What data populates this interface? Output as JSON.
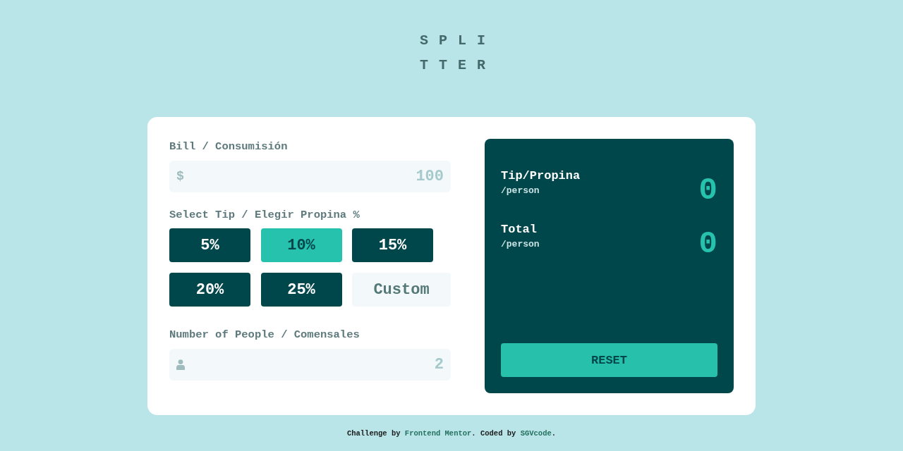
{
  "logo": "SPLITTER",
  "bill": {
    "label": "Bill / Consumisión",
    "prefix": "$",
    "placeholder": "100"
  },
  "tip": {
    "label": "Select Tip / Elegir Propina %",
    "options": [
      {
        "label": "5%",
        "selected": false
      },
      {
        "label": "10%",
        "selected": true
      },
      {
        "label": "15%",
        "selected": false
      },
      {
        "label": "20%",
        "selected": false
      },
      {
        "label": "25%",
        "selected": false
      }
    ],
    "custom": {
      "placeholder": "Custom"
    }
  },
  "people": {
    "label": "Number of People / Comensales",
    "placeholder": "2"
  },
  "results": [
    {
      "title": "Tip/Propina",
      "unit": "/person",
      "amount": "0"
    },
    {
      "title": "Total",
      "unit": "/person",
      "amount": "0"
    }
  ],
  "reset": {
    "label": "RESET"
  },
  "footer": {
    "segments": [
      {
        "kind": "text",
        "text": "Challenge by "
      },
      {
        "kind": "link",
        "text": "Frontend Mentor"
      },
      {
        "kind": "text",
        "text": ". Coded by "
      },
      {
        "kind": "link",
        "text": "SGVcode"
      },
      {
        "kind": "text",
        "text": "."
      }
    ]
  }
}
